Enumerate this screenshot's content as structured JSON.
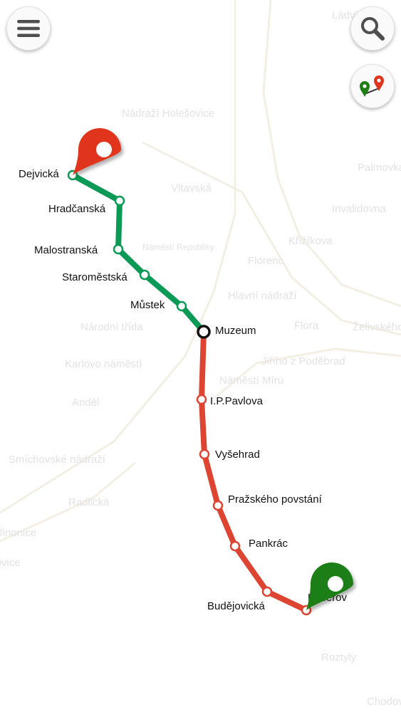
{
  "toolbar": {
    "menu_icon": "hamburger-menu-icon",
    "search_icon": "search-icon",
    "route_icon": "route-pins-icon"
  },
  "colors": {
    "line_a": "#0a9a56",
    "line_c": "#de4432",
    "transfer_station": "#111111",
    "start_pin": "#1f7e13",
    "end_pin": "#e0341f",
    "faded_label": "#e3e3e3"
  },
  "route": {
    "origin": "Kačerov",
    "destination": "Dejvická",
    "transfer": "Muzeum",
    "stations": [
      {
        "name": "Dejvická",
        "line": "A"
      },
      {
        "name": "Hradčanská",
        "line": "A"
      },
      {
        "name": "Malostranská",
        "line": "A"
      },
      {
        "name": "Staroměstská",
        "line": "A"
      },
      {
        "name": "Můstek",
        "line": "A"
      },
      {
        "name": "Muzeum",
        "line": "transfer"
      },
      {
        "name": "I.P.Pavlova",
        "line": "C"
      },
      {
        "name": "Vyšehrad",
        "line": "C"
      },
      {
        "name": "Pražského povstání",
        "line": "C"
      },
      {
        "name": "Pankrác",
        "line": "C"
      },
      {
        "name": "Budějovická",
        "line": "C"
      },
      {
        "name": "Kačerov",
        "line": "C"
      }
    ]
  },
  "background_stations": [
    "Ládví",
    "Nádraží Holešovice",
    "Palmovka",
    "Vltavská",
    "Invalidovna",
    "Náměstí Republiky",
    "Křižíkova",
    "Florenc",
    "Hlavní nádraží",
    "Národní třída",
    "Flora",
    "Želivského",
    "Jiřího z Poděbrad",
    "Karlovo náměstí",
    "Náměstí Míru",
    "Anděl",
    "Smíchovské nádraží",
    "Radlická",
    "Jinonice",
    "Nové Butovice",
    "Roztyly",
    "Chodov"
  ]
}
